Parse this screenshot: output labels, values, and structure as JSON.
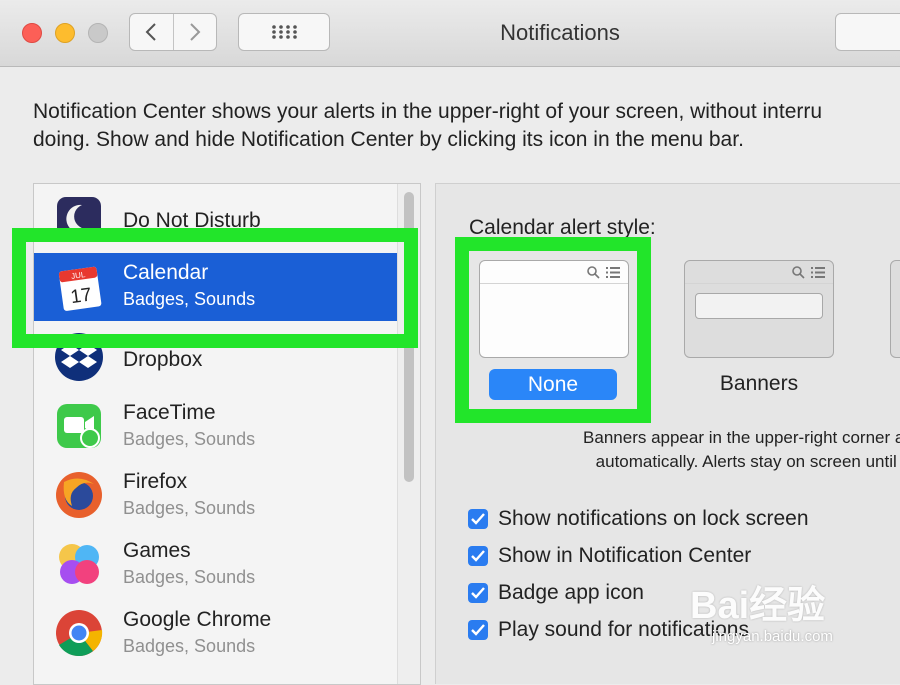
{
  "window": {
    "title": "Notifications"
  },
  "description": {
    "line1": "Notification Center shows your alerts in the upper-right of your screen, without interru",
    "line2": "doing. Show and hide Notification Center by clicking its icon in the menu bar."
  },
  "apps": [
    {
      "name": "Do Not Disturb",
      "sub": "",
      "icon": "moon-icon"
    },
    {
      "name": "Calendar",
      "sub": "Badges, Sounds",
      "icon": "calendar-icon",
      "selected": true,
      "icon_month": "JUL",
      "icon_day": "17"
    },
    {
      "name": "Dropbox",
      "sub": "",
      "icon": "dropbox-icon"
    },
    {
      "name": "FaceTime",
      "sub": "Badges, Sounds",
      "icon": "facetime-icon"
    },
    {
      "name": "Firefox",
      "sub": "Badges, Sounds",
      "icon": "firefox-icon"
    },
    {
      "name": "Games",
      "sub": "Badges, Sounds",
      "icon": "games-icon"
    },
    {
      "name": "Google Chrome",
      "sub": "Badges, Sounds",
      "icon": "chrome-icon"
    }
  ],
  "alert_style": {
    "label": "Calendar alert style:",
    "options": [
      "None",
      "Banners"
    ],
    "selected": "None",
    "help_line1": "Banners appear in the upper-right corner ar",
    "help_line2": "automatically. Alerts stay on screen until c"
  },
  "checkboxes": [
    {
      "label": "Show notifications on lock screen",
      "checked": true
    },
    {
      "label": "Show in Notification Center",
      "checked": true
    },
    {
      "label": "Badge app icon",
      "checked": true
    },
    {
      "label": "Play sound for notifications",
      "checked": true
    }
  ],
  "watermark": {
    "text": "Bai经验",
    "url": "jingyan.baidu.com"
  },
  "colors": {
    "selection": "#1a5fd6",
    "accent": "#2a86f8",
    "highlight": "#22e52a"
  }
}
